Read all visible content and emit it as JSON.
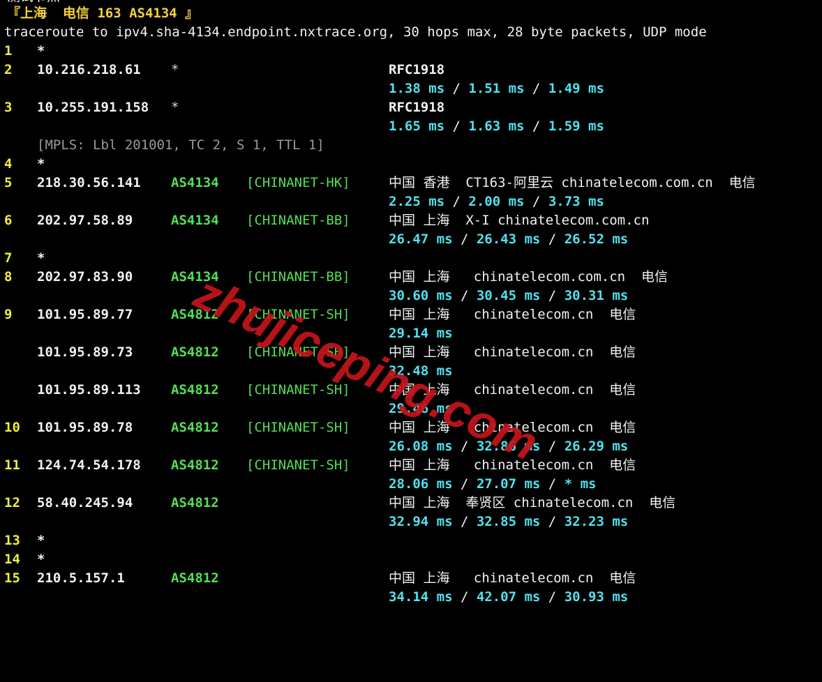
{
  "previous_line": "测试节点",
  "header": "『上海  电信 163 AS4134 』",
  "title": "traceroute to ipv4.sha-4134.endpoint.nxtrace.org, 30 hops max, 28 byte packets, UDP mode",
  "mpls": "[MPLS: Lbl 201001, TC 2, S 1, TTL 1]",
  "watermark": "zhujiceping.com",
  "sep": " / ",
  "hops": {
    "h1": {
      "hop": "1",
      "ip": "*"
    },
    "h2": {
      "hop": "2",
      "ip": "10.216.218.61",
      "asn_star": "*",
      "geo": "RFC1918",
      "rtt": [
        "1.38 ms",
        "1.51 ms",
        "1.49 ms"
      ]
    },
    "h3": {
      "hop": "3",
      "ip": "10.255.191.158",
      "asn_star": "*",
      "geo": "RFC1918",
      "rtt": [
        "1.65 ms",
        "1.63 ms",
        "1.59 ms"
      ]
    },
    "h4": {
      "hop": "4",
      "ip": "*"
    },
    "h5": {
      "hop": "5",
      "ip": "218.30.56.141",
      "asn": "AS4134",
      "tag": "[CHINANET-HK]",
      "geo": "中国 香港  CT163-阿里云 chinatelecom.com.cn  电信",
      "rtt": [
        "2.25 ms",
        "2.00 ms",
        "3.73 ms"
      ]
    },
    "h6": {
      "hop": "6",
      "ip": "202.97.58.89",
      "asn": "AS4134",
      "tag": "[CHINANET-BB]",
      "geo": "中国 上海  X-I chinatelecom.com.cn",
      "rtt": [
        "26.47 ms",
        "26.43 ms",
        "26.52 ms"
      ]
    },
    "h7": {
      "hop": "7",
      "ip": "*"
    },
    "h8": {
      "hop": "8",
      "ip": "202.97.83.90",
      "asn": "AS4134",
      "tag": "[CHINANET-BB]",
      "geo": "中国 上海   chinatelecom.com.cn  电信",
      "rtt": [
        "30.60 ms",
        "30.45 ms",
        "30.31 ms"
      ]
    },
    "h9": {
      "hop": "9",
      "ip": "101.95.89.77",
      "asn": "AS4812",
      "tag": "[CHINANET-SH]",
      "geo": "中国 上海   chinatelecom.cn  电信",
      "rtt": [
        "29.14 ms"
      ]
    },
    "h9b": {
      "ip": "101.95.89.73",
      "asn": "AS4812",
      "tag": "[CHINANET-SH]",
      "geo": "中国 上海   chinatelecom.cn  电信",
      "rtt": [
        "32.48 ms"
      ]
    },
    "h9c": {
      "ip": "101.95.89.113",
      "asn": "AS4812",
      "tag": "[CHINANET-SH]",
      "geo": "中国 上海   chinatelecom.cn  电信",
      "rtt": [
        "29.46 ms"
      ]
    },
    "h10": {
      "hop": "10",
      "ip": "101.95.89.78",
      "asn": "AS4812",
      "tag": "[CHINANET-SH]",
      "geo": "中国 上海   chinatelecom.cn  电信",
      "rtt": [
        "26.08 ms",
        "32.86 ms",
        "26.29 ms"
      ]
    },
    "h11": {
      "hop": "11",
      "ip": "124.74.54.178",
      "asn": "AS4812",
      "tag": "[CHINANET-SH]",
      "geo": "中国 上海   chinatelecom.cn  电信",
      "rtt": [
        "28.06 ms",
        "27.07 ms",
        "* ms"
      ]
    },
    "h12": {
      "hop": "12",
      "ip": "58.40.245.94",
      "asn": "AS4812",
      "geo": "中国 上海  奉贤区 chinatelecom.cn  电信",
      "rtt": [
        "32.94 ms",
        "32.85 ms",
        "32.23 ms"
      ]
    },
    "h13": {
      "hop": "13",
      "ip": "*"
    },
    "h14": {
      "hop": "14",
      "ip": "*"
    },
    "h15": {
      "hop": "15",
      "ip": "210.5.157.1",
      "asn": "AS4812",
      "geo": "中国 上海   chinatelecom.cn  电信",
      "rtt": [
        "34.14 ms",
        "42.07 ms",
        "30.93 ms"
      ]
    }
  }
}
